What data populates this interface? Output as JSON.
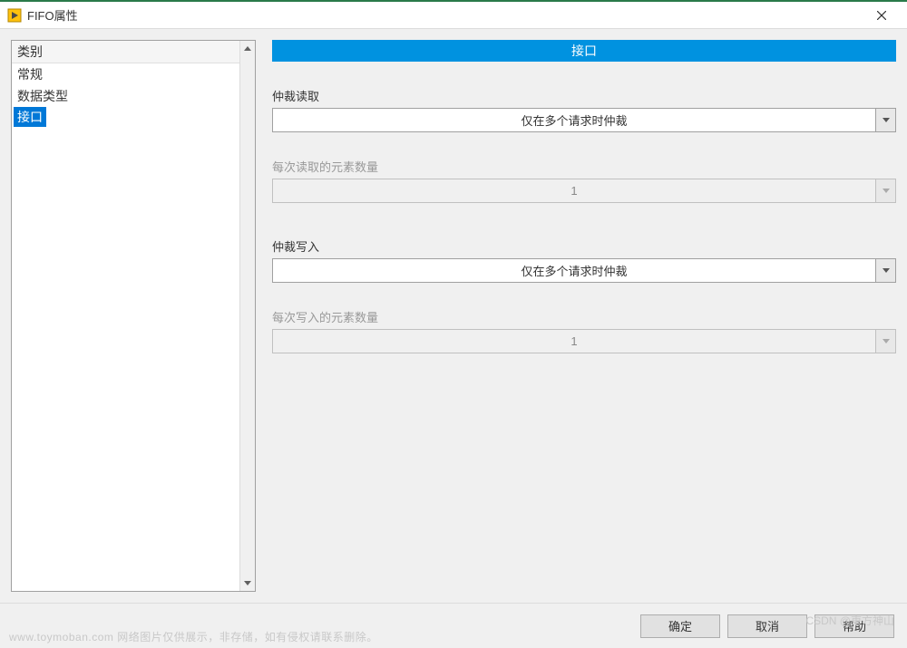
{
  "window": {
    "title": "FIFO属性"
  },
  "sidebar": {
    "header": "类别",
    "items": [
      {
        "label": "常规"
      },
      {
        "label": "数据类型"
      },
      {
        "label": "接口",
        "selected": true
      }
    ]
  },
  "main": {
    "section_title": "接口",
    "groups": [
      {
        "label": "仲裁读取",
        "value": "仅在多个请求时仲裁",
        "disabled": false
      },
      {
        "label": "每次读取的元素数量",
        "value": "1",
        "disabled": true
      },
      {
        "label": "仲裁写入",
        "value": "仅在多个请求时仲裁",
        "disabled": false
      },
      {
        "label": "每次写入的元素数量",
        "value": "1",
        "disabled": true
      }
    ]
  },
  "footer": {
    "ok": "确定",
    "cancel": "取消",
    "help": "帮助"
  },
  "watermark": {
    "left": "www.toymoban.com 网络图片仅供展示，非存储，如有侵权请联系删除。",
    "right": "CSDN @東方神山"
  }
}
